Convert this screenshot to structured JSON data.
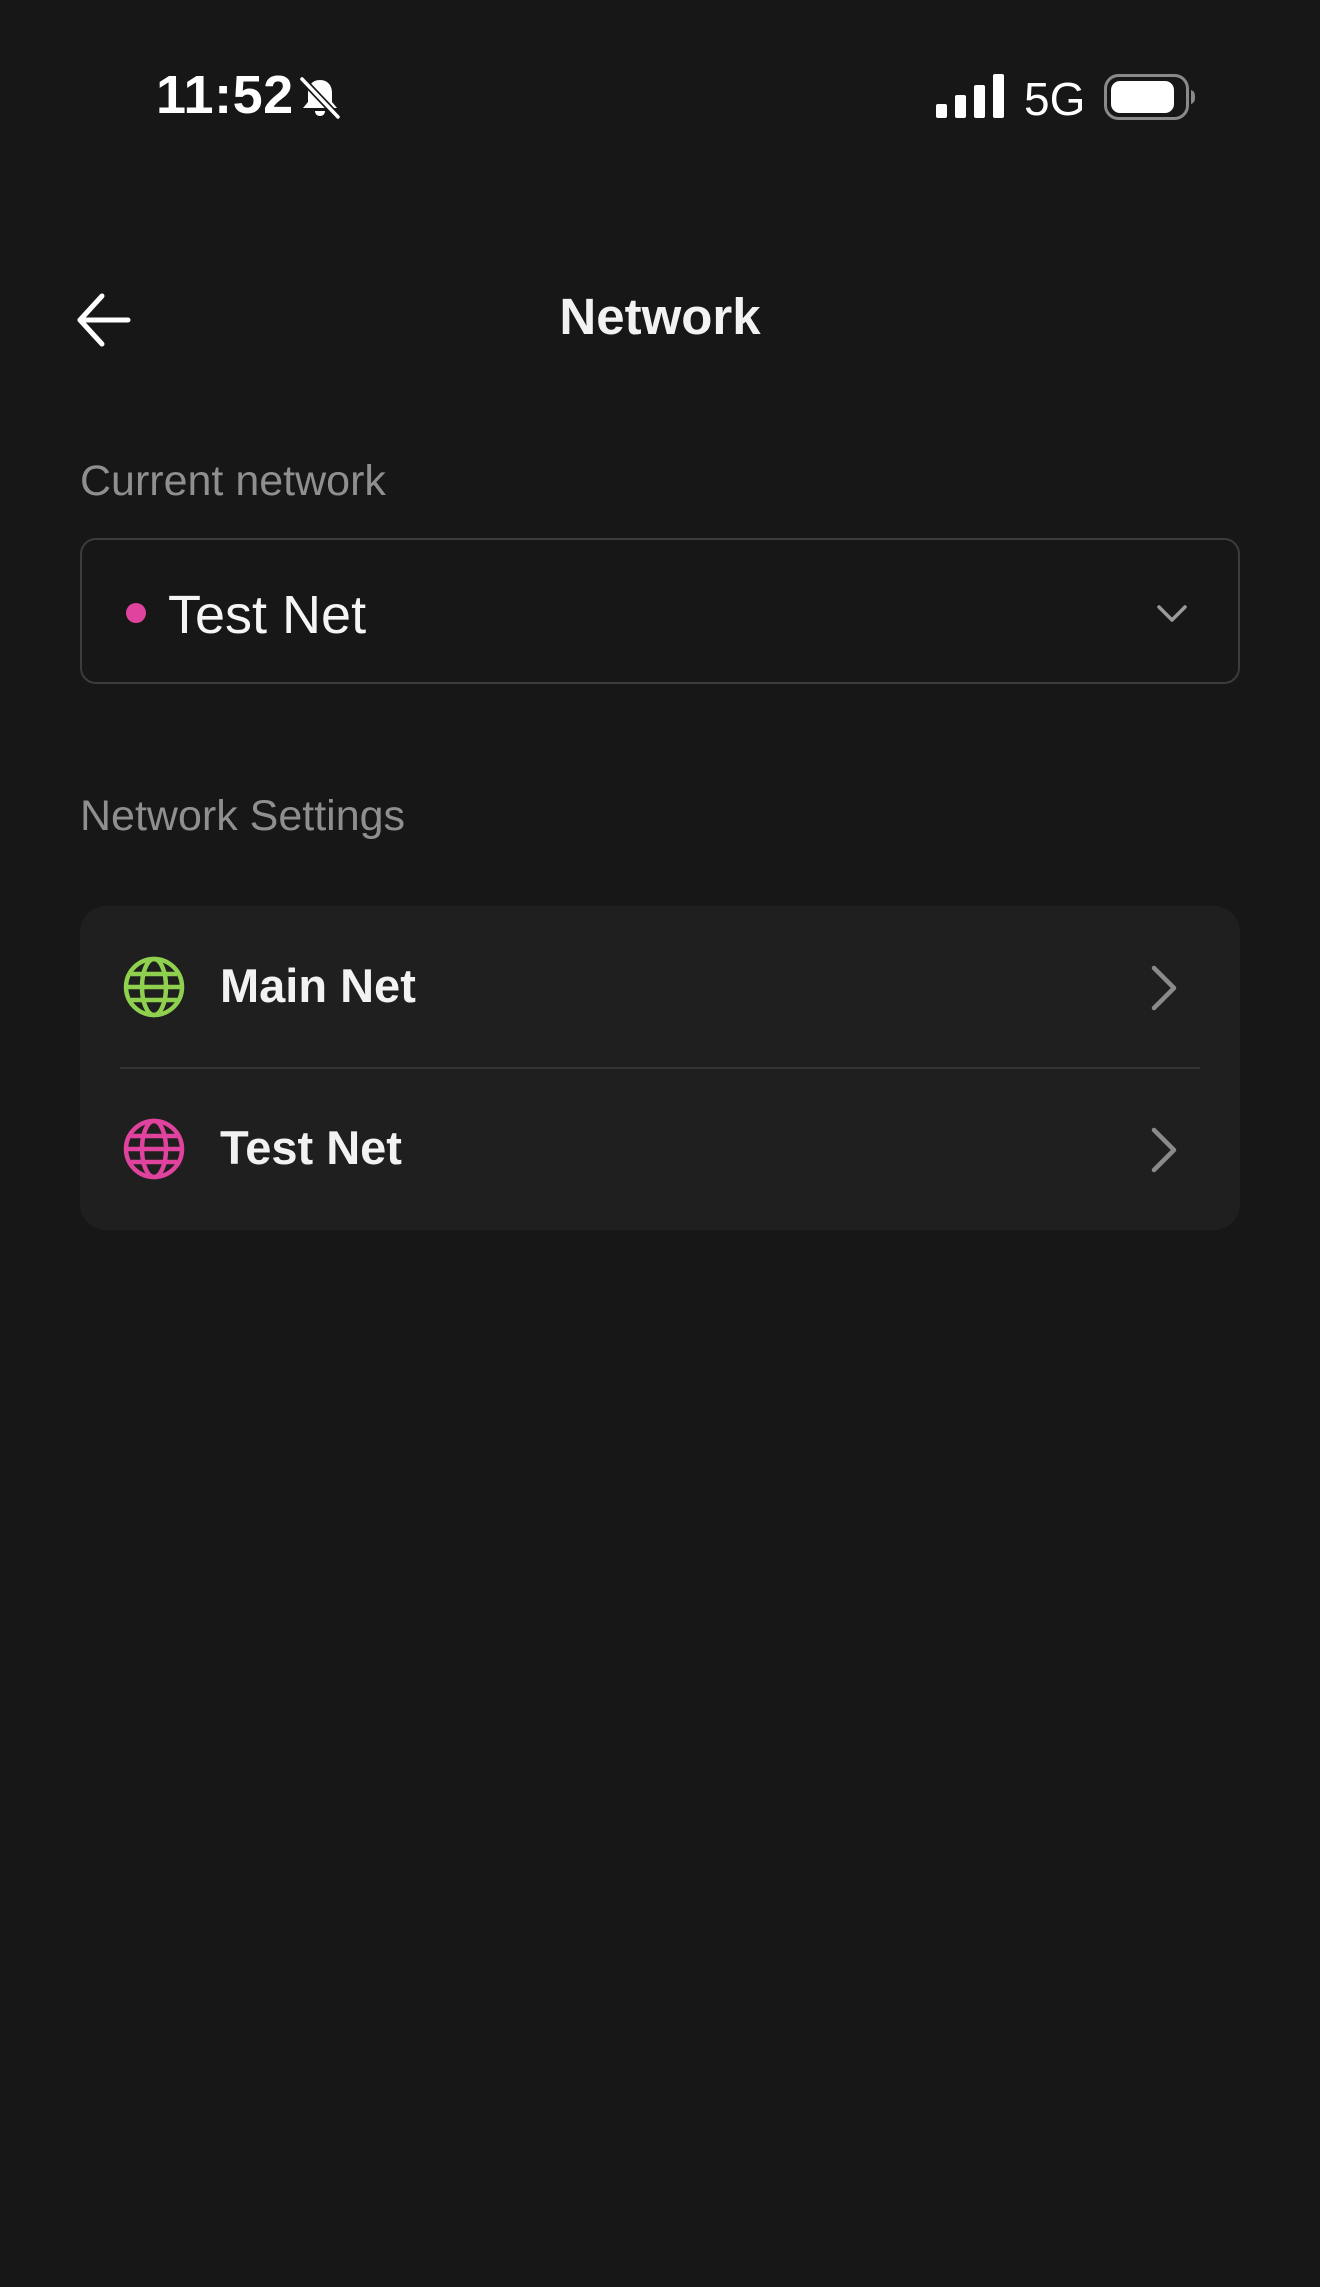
{
  "status_bar": {
    "time": "11:52",
    "network_type": "5G",
    "icons": [
      "bell-slash-icon",
      "signal-icon",
      "battery-icon"
    ]
  },
  "header": {
    "title": "Network",
    "back_icon": "arrow-left-icon"
  },
  "current_network": {
    "label": "Current network",
    "selected_value": "Test Net",
    "dot_color": "#e0439d",
    "dropdown_icon": "chevron-down-icon"
  },
  "network_settings": {
    "label": "Network Settings",
    "items": [
      {
        "label": "Main Net",
        "icon": "globe-icon",
        "icon_color": "#8fd14f"
      },
      {
        "label": "Test Net",
        "icon": "globe-icon",
        "icon_color": "#e0439d"
      }
    ]
  },
  "colors": {
    "background": "#171717",
    "card": "#1f1f1f",
    "muted_text": "#8f8f8f",
    "main_net": "#8fd14f",
    "test_net": "#e0439d"
  }
}
